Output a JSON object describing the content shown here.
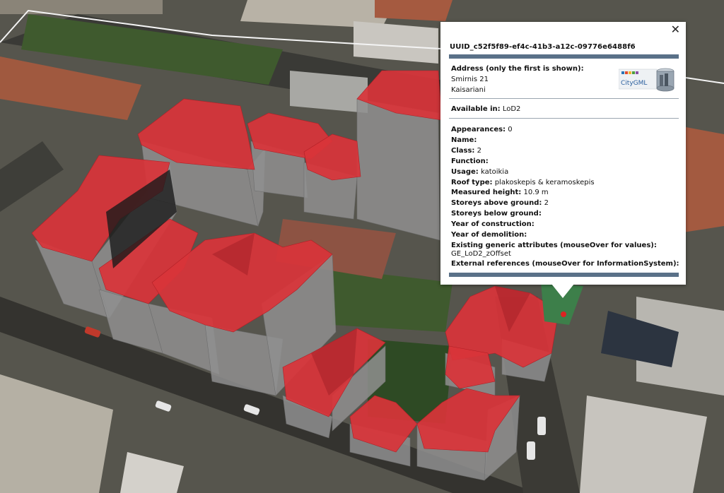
{
  "popup": {
    "uuid": "UUID_c52f5f89-ef4c-41b3-a12c-09776e6488f6",
    "address_label": "Address (only the first is shown):",
    "address_line1": "Smirnis 21",
    "address_line2": "Kaisariani",
    "logo_text": "CityGML",
    "available_label": "Available in:",
    "available_value": "LoD2",
    "appearances_label": "Appearances:",
    "appearances_value": "0",
    "name_label": "Name:",
    "class_label": "Class:",
    "class_value": "2",
    "function_label": "Function:",
    "usage_label": "Usage:",
    "usage_value": "katoikia",
    "roof_label": "Roof type:",
    "roof_value": "plakoskepis & keramoskepis",
    "height_label": "Measured height:",
    "height_value": "10.9 m",
    "storeys_above_label": "Storeys above ground:",
    "storeys_above_value": "2",
    "storeys_below_label": "Storeys below ground:",
    "year_construction_label": "Year of construction:",
    "year_demolition_label": "Year of demolition:",
    "generic_label": "Existing generic attributes (mouseOver for values):",
    "generic_value": "GE_LoD2_zOffset",
    "external_label": "External references (mouseOver for InformationSystem):",
    "close_icon": "close-icon"
  },
  "colors": {
    "roof": "#d9343a",
    "wall": "#8f8f8f",
    "header_bar": "#5a7188"
  }
}
